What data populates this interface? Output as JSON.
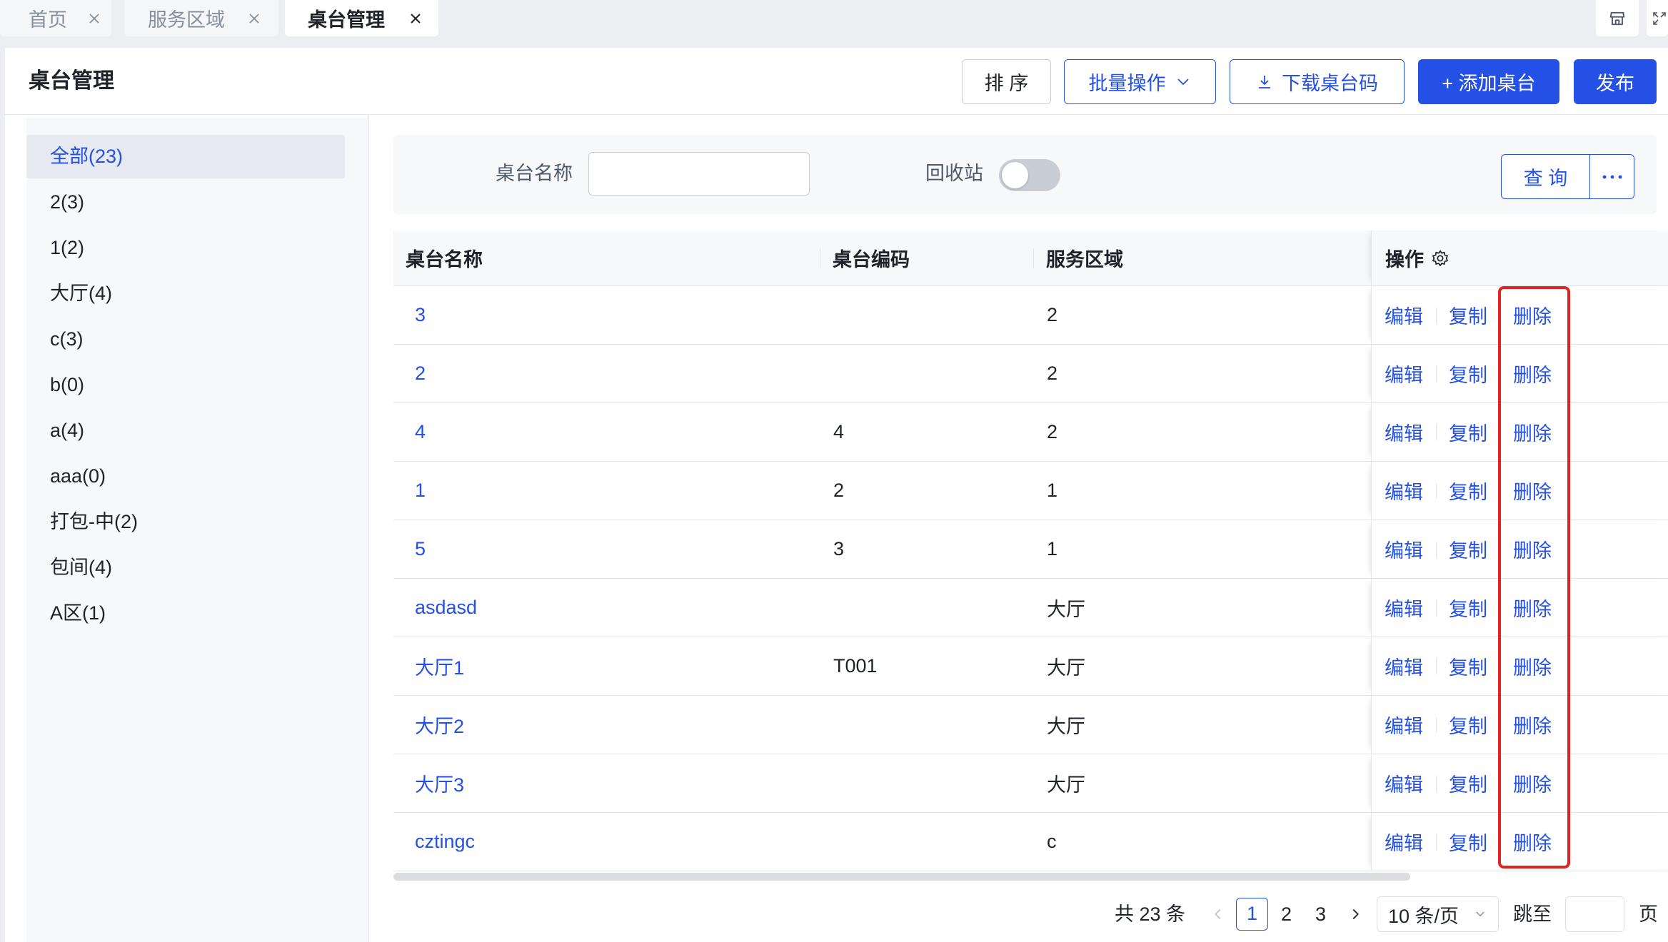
{
  "tabs": [
    {
      "label": "首页",
      "active": false
    },
    {
      "label": "服务区域",
      "active": false
    },
    {
      "label": "桌台管理",
      "active": true
    }
  ],
  "header": {
    "title": "桌台管理",
    "sort_label": "排 序",
    "batch_label": "批量操作",
    "download_label": "下载桌台码",
    "add_label": "+ 添加桌台",
    "publish_label": "发布"
  },
  "sidebar": {
    "items": [
      {
        "label": "全部(23)",
        "selected": true
      },
      {
        "label": "2(3)",
        "selected": false
      },
      {
        "label": "1(2)",
        "selected": false
      },
      {
        "label": "大厅(4)",
        "selected": false
      },
      {
        "label": "c(3)",
        "selected": false
      },
      {
        "label": "b(0)",
        "selected": false
      },
      {
        "label": "a(4)",
        "selected": false
      },
      {
        "label": "aaa(0)",
        "selected": false
      },
      {
        "label": "打包-中(2)",
        "selected": false
      },
      {
        "label": "包间(4)",
        "selected": false
      },
      {
        "label": "A区(1)",
        "selected": false
      }
    ]
  },
  "filter": {
    "name_label": "桌台名称",
    "name_value": "",
    "recycle_label": "回收站",
    "recycle_enabled": false,
    "query_label": "查 询"
  },
  "table": {
    "columns": {
      "name": "桌台名称",
      "code": "桌台编码",
      "area": "服务区域",
      "actions": "操作"
    },
    "rows": [
      {
        "name": "3",
        "code": "",
        "area": "2"
      },
      {
        "name": "2",
        "code": "",
        "area": "2"
      },
      {
        "name": "4",
        "code": "4",
        "area": "2"
      },
      {
        "name": "1",
        "code": "2",
        "area": "1"
      },
      {
        "name": "5",
        "code": "3",
        "area": "1"
      },
      {
        "name": "asdasd",
        "code": "",
        "area": "大厅"
      },
      {
        "name": "大厅1",
        "code": "T001",
        "area": "大厅"
      },
      {
        "name": "大厅2",
        "code": "",
        "area": "大厅"
      },
      {
        "name": "大厅3",
        "code": "",
        "area": "大厅"
      },
      {
        "name": "cztingc",
        "code": "",
        "area": "c"
      }
    ],
    "row_actions": [
      "编辑",
      "复制",
      "删除"
    ]
  },
  "pagination": {
    "total_label": "共 23 条",
    "pages": [
      "1",
      "2",
      "3"
    ],
    "current": "1",
    "page_size": "10 条/页",
    "jump_label": "跳至",
    "jump_value": "",
    "page_suffix": "页"
  },
  "icons": {
    "tab_close": "close-icon",
    "top_right": [
      "layout-icon",
      "fullscreen-icon"
    ],
    "batch": "chevron-down-icon",
    "download": "download-icon",
    "more": "more-icon",
    "column_settings": "settings-icon",
    "pager": [
      "chevron-left-icon",
      "chevron-right-icon"
    ]
  },
  "colors": {
    "primary": "#2450e5",
    "highlight": "#e02424",
    "text": "#1f2329"
  }
}
